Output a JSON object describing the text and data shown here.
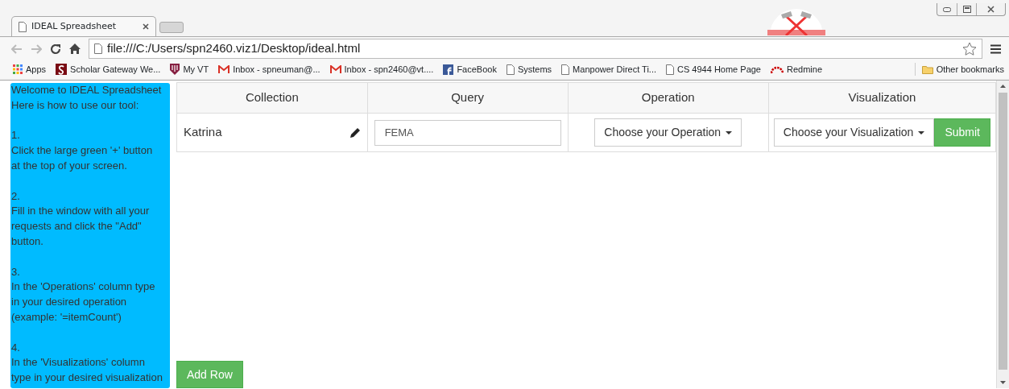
{
  "browser": {
    "tab_title": "IDEAL Spreadsheet",
    "address": "file:///C:/Users/spn2460.viz1/Desktop/ideal.html",
    "bookmarks": [
      {
        "label": "Apps",
        "kind": "apps"
      },
      {
        "label": "Scholar Gateway We...",
        "kind": "scholar"
      },
      {
        "label": "My VT",
        "kind": "shield"
      },
      {
        "label": "Inbox - spneuman@...",
        "kind": "mail"
      },
      {
        "label": "Inbox - spn2460@vt....",
        "kind": "mail"
      },
      {
        "label": "FaceBook",
        "kind": "facebook"
      },
      {
        "label": "Systems",
        "kind": "page"
      },
      {
        "label": "Manpower Direct Ti...",
        "kind": "page"
      },
      {
        "label": "CS 4944 Home Page",
        "kind": "page"
      },
      {
        "label": "Redmine",
        "kind": "redmine"
      }
    ],
    "other_bookmarks": "Other bookmarks"
  },
  "sidebar": {
    "intro": [
      "Welcome to IDEAL Spreadsheet",
      "Here is how to use our tool:"
    ],
    "steps": [
      {
        "number": "1.",
        "text": "Click the large green '+' button at the top of your screen."
      },
      {
        "number": "2.",
        "text": "Fill in the window with all your requests and click the \"Add\" button."
      },
      {
        "number": "3.",
        "text": "In the 'Operations' column type in your desired operation (example: '=itemCount')"
      },
      {
        "number": "4.",
        "text": "In the 'Visualizations' column type in your desired visualization"
      }
    ]
  },
  "table": {
    "columns": [
      "Collection",
      "Query",
      "Operation",
      "Visualization"
    ],
    "rows": [
      {
        "collection": "Katrina",
        "query": "FEMA",
        "operation": "Choose your Operation",
        "visualization": "Choose your Visualization",
        "submit": "Submit"
      }
    ]
  },
  "add_row_button": "Add Row"
}
